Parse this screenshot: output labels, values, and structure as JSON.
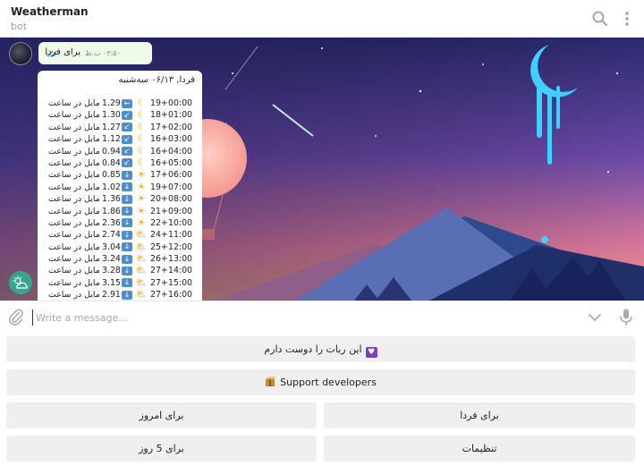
{
  "header": {
    "title": "Weatherman",
    "subtitle": "bot"
  },
  "outgoing": {
    "text": "برای فردا",
    "time": "۰۳:۵۰ ب.ظ"
  },
  "forecast": {
    "heading": "فردا, ۰۶/۱۳ سه‌شنبه",
    "row_label": "مایل در ساعت",
    "rows": [
      {
        "time": "00:00",
        "temp": "19+",
        "icon": "moon-icon",
        "arrow": "←",
        "wind": "1.29"
      },
      {
        "time": "01:00",
        "temp": "18+",
        "icon": "moon-icon",
        "arrow": "↙",
        "wind": "1.30"
      },
      {
        "time": "02:00",
        "temp": "17+",
        "icon": "moon-icon",
        "arrow": "↙",
        "wind": "1.27"
      },
      {
        "time": "03:00",
        "temp": "16+",
        "icon": "moon-icon",
        "arrow": "↙",
        "wind": "1.12"
      },
      {
        "time": "04:00",
        "temp": "16+",
        "icon": "moon-icon",
        "arrow": "↙",
        "wind": "0.94"
      },
      {
        "time": "05:00",
        "temp": "16+",
        "icon": "moon-icon",
        "arrow": "↙",
        "wind": "0.84"
      },
      {
        "time": "06:00",
        "temp": "17+",
        "icon": "sun-icon",
        "arrow": "↓",
        "wind": "0.85"
      },
      {
        "time": "07:00",
        "temp": "19+",
        "icon": "sun-icon",
        "arrow": "↓",
        "wind": "1.02"
      },
      {
        "time": "08:00",
        "temp": "20+",
        "icon": "sun-icon",
        "arrow": "↓",
        "wind": "1.36"
      },
      {
        "time": "09:00",
        "temp": "21+",
        "icon": "sun-icon",
        "arrow": "↓",
        "wind": "1.86"
      },
      {
        "time": "10:00",
        "temp": "22+",
        "icon": "sun-icon",
        "arrow": "↓",
        "wind": "2.36"
      },
      {
        "time": "11:00",
        "temp": "24+",
        "icon": "partly-cloudy-icon",
        "arrow": "↓",
        "wind": "2.74"
      },
      {
        "time": "12:00",
        "temp": "25+",
        "icon": "partly-cloudy-icon",
        "arrow": "↓",
        "wind": "3.04"
      },
      {
        "time": "13:00",
        "temp": "26+",
        "icon": "partly-cloudy-icon",
        "arrow": "↓",
        "wind": "3.24"
      },
      {
        "time": "14:00",
        "temp": "27+",
        "icon": "partly-cloudy-icon",
        "arrow": "↓",
        "wind": "3.28"
      },
      {
        "time": "15:00",
        "temp": "27+",
        "icon": "partly-cloudy-icon",
        "arrow": "↓",
        "wind": "3.15"
      },
      {
        "time": "16:00",
        "temp": "27+",
        "icon": "partly-cloudy-icon",
        "arrow": "↓",
        "wind": "2.91"
      }
    ]
  },
  "input": {
    "placeholder": "Write a message..."
  },
  "keyboard": {
    "love_label": "این ربات را دوست دارم",
    "support_label": "Support developers",
    "today_label": "برای امروز",
    "tomorrow_label": "برای فردا",
    "five_days_label": "برای 5 روز",
    "settings_label": "تنظیمات"
  },
  "colors": {
    "accent": "#4f8fc9",
    "bot_button": "#35a58b",
    "outgoing_bubble": "#eefbe8",
    "keyboard_button": "#efefef"
  }
}
